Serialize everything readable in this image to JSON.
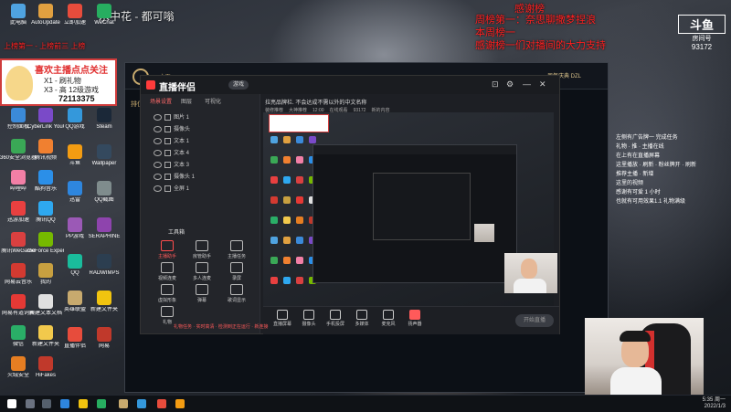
{
  "overlay_top_center": "水中花 - 都可嗡",
  "overlay_top_left": "上榜第一 - 上榜前三 上榜",
  "overlay_right": [
    "感谢榜",
    "周榜第一：奈思聊撒梦捏浪",
    "本周榜一",
    "感谢榜一们对播间的大力支持"
  ],
  "watermark": {
    "logo": "斗鱼",
    "label": "房间号",
    "room": "93172"
  },
  "badge": {
    "title": "喜欢主播点点关注",
    "line1": "X1 - 刷礼物",
    "line2": "X3 - 高 12级游戏",
    "number": "72113375"
  },
  "desktop_icons_left": [
    {
      "label": "此电脑",
      "color": "#4fa3e0"
    },
    {
      "label": "AutoUpdate",
      "color": "#e0a040"
    },
    {
      "label": "控制面板",
      "color": "#3b8ad9"
    },
    {
      "label": "CyberLink YouCam 7",
      "color": "#7a4ac8"
    },
    {
      "label": "360安全浏览器",
      "color": "#3aa856"
    },
    {
      "label": "腾讯视频",
      "color": "#f08030"
    },
    {
      "label": "哔哩哔",
      "color": "#f27fa6"
    },
    {
      "label": "酷狗音乐",
      "color": "#2b8fe8"
    },
    {
      "label": "迅游加速",
      "color": "#e84040"
    },
    {
      "label": "腾讯QQ",
      "color": "#2ea8f0"
    },
    {
      "label": "腾讯WeGame",
      "color": "#d94040"
    },
    {
      "label": "GeForce Experience",
      "color": "#76b900"
    },
    {
      "label": "网易云音乐",
      "color": "#d33a31"
    },
    {
      "label": "我的",
      "color": "#c8a040"
    },
    {
      "label": "网易有道词典",
      "color": "#e53935"
    },
    {
      "label": "新建文本文档",
      "color": "#e0e0e0"
    },
    {
      "label": "微信",
      "color": "#2aae67"
    },
    {
      "label": "新建文件夹",
      "color": "#f2c94c"
    },
    {
      "label": "火绒安全",
      "color": "#e67e22"
    },
    {
      "label": "HiFakes",
      "color": "#c0392b"
    }
  ],
  "desktop_icons_col3": [
    {
      "label": "立即加速",
      "color": "#e74c3c"
    },
    {
      "label": "QQ游戏",
      "color": "#3498db"
    },
    {
      "label": "斗鱼",
      "color": "#f39c12"
    },
    {
      "label": "迅雷",
      "color": "#2e86de"
    },
    {
      "label": "PP游戏",
      "color": "#9b59b6"
    },
    {
      "label": "QQ",
      "color": "#1abc9c"
    },
    {
      "label": "英雄联盟",
      "color": "#c8aa6e"
    },
    {
      "label": "直播伴侣",
      "color": "#e74c3c"
    }
  ],
  "desktop_icons_col4": [
    {
      "label": "WeChat",
      "color": "#27ae60"
    },
    {
      "label": "Steam",
      "color": "#1b2838"
    },
    {
      "label": "Wallpaper",
      "color": "#34495e"
    },
    {
      "label": "QQ截图",
      "color": "#7f8c8d"
    },
    {
      "label": "SERAPHINE",
      "color": "#8e44ad"
    },
    {
      "label": "RADWIMPS",
      "color": "#2c3e50"
    },
    {
      "label": "新建文件夹",
      "color": "#f1c40f"
    },
    {
      "label": "网易",
      "color": "#c0392b"
    }
  ],
  "lol": {
    "nav_left": "一 主页",
    "nav_mid": "排位赛",
    "right_label": "周年庆典 DZL"
  },
  "zbw": {
    "title": "直播伴侣",
    "btn": "游戏",
    "tabs": [
      "场景设置",
      "图层",
      "可视化"
    ],
    "tools_title": "工具箱",
    "layers": [
      "图片 1",
      "摄像头",
      "文本 1",
      "文本 4",
      "文本 3",
      "摄像头 1",
      "全屏 1"
    ],
    "tools": [
      "主播助手",
      "房管助手",
      "主播任务",
      "视频连麦",
      "多人连麦",
      "录屏",
      "虚拟形象",
      "弹幕",
      "歌词显示",
      "礼物"
    ],
    "preview_header": "拉亮品牌栏. 不会达成不需以外的中文名称",
    "preview_subtags": [
      "装修推荐",
      "大神推荐",
      "12:00",
      "在线观看",
      "93172",
      "新的内容"
    ],
    "bottom": [
      "直播屏幕",
      "摄像头",
      "手机投屏",
      "多媒体",
      "麦克风",
      "扬声器"
    ],
    "golive": "开始直播",
    "status": "礼物任务 · 实时高清 · 检测到正在运行 · 新连接"
  },
  "right_chat": [
    "左侧有广告牌一 完成任务",
    "礼物 · 推 · 主播在线",
    "在上有在直播屏幕",
    "这里播放 · 刷新 · 粉丝牌开 · 刷新",
    "推荐主播 · 新增",
    "这里的视频",
    "感谢有可爱 1 小时",
    "也就有可用效果1.1 礼物满级"
  ],
  "taskbar": {
    "time": "5:35 周一",
    "date": "2022/1/3"
  }
}
